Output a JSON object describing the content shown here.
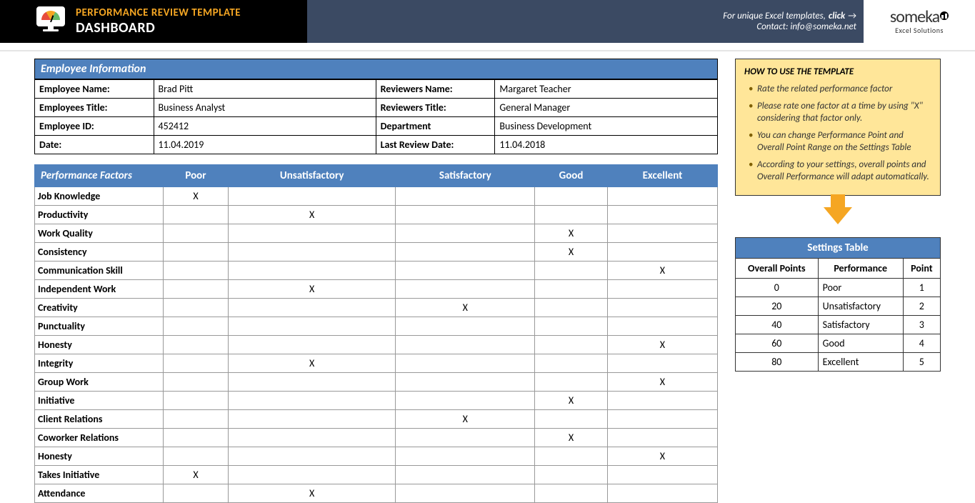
{
  "header": {
    "title1": "PERFORMANCE REVIEW TEMPLATE",
    "title2": "DASHBOARD",
    "link_text": "For unique Excel templates, ",
    "link_action": "click",
    "contact": "Contact: info@someka.net",
    "logo_main": "someka",
    "logo_sub": "Excel Solutions"
  },
  "employee_info": {
    "header": "Employee Information",
    "labels": {
      "emp_name": "Employee Name:",
      "emp_title": "Employees Title:",
      "emp_id": "Employee ID:",
      "date": "Date:",
      "rev_name": "Reviewers Name:",
      "rev_title": "Reviewers Title:",
      "dept": "Department",
      "last_review": "Last Review Date:"
    },
    "values": {
      "emp_name": "Brad Pitt",
      "emp_title": "Business Analyst",
      "emp_id": "452412",
      "date": "11.04.2019",
      "rev_name": "Margaret Teacher",
      "rev_title": "General Manager",
      "dept": "Business Development",
      "last_review": "11.04.2018"
    }
  },
  "performance": {
    "header": "Performance Factors",
    "columns": [
      "Poor",
      "Unsatisfactory",
      "Satisfactory",
      "Good",
      "Excellent"
    ],
    "rows": [
      {
        "name": "Job Knowledge",
        "marks": [
          "X",
          "",
          "",
          "",
          ""
        ]
      },
      {
        "name": "Productivity",
        "marks": [
          "",
          "X",
          "",
          "",
          ""
        ]
      },
      {
        "name": "Work Quality",
        "marks": [
          "",
          "",
          "",
          "X",
          ""
        ]
      },
      {
        "name": "Consistency",
        "marks": [
          "",
          "",
          "",
          "X",
          ""
        ]
      },
      {
        "name": "Communication Skill",
        "marks": [
          "",
          "",
          "",
          "",
          "X"
        ]
      },
      {
        "name": "Independent Work",
        "marks": [
          "",
          "X",
          "",
          "",
          ""
        ]
      },
      {
        "name": "Creativity",
        "marks": [
          "",
          "",
          "X",
          "",
          ""
        ]
      },
      {
        "name": "Punctuality",
        "marks": [
          "",
          "",
          "",
          "",
          ""
        ]
      },
      {
        "name": "Honesty",
        "marks": [
          "",
          "",
          "",
          "",
          "X"
        ]
      },
      {
        "name": "Integrity",
        "marks": [
          "",
          "X",
          "",
          "",
          ""
        ]
      },
      {
        "name": "Group Work",
        "marks": [
          "",
          "",
          "",
          "",
          "X"
        ]
      },
      {
        "name": "Initiative",
        "marks": [
          "",
          "",
          "",
          "X",
          ""
        ]
      },
      {
        "name": "Client Relations",
        "marks": [
          "",
          "",
          "X",
          "",
          ""
        ]
      },
      {
        "name": "Coworker Relations",
        "marks": [
          "",
          "",
          "",
          "X",
          ""
        ]
      },
      {
        "name": "Honesty",
        "marks": [
          "",
          "",
          "",
          "",
          "X"
        ]
      },
      {
        "name": "Takes Initiative",
        "marks": [
          "X",
          "",
          "",
          "",
          ""
        ]
      },
      {
        "name": "Attendance",
        "marks": [
          "",
          "X",
          "",
          "",
          ""
        ]
      }
    ]
  },
  "howto": {
    "title": "HOW TO USE THE TEMPLATE",
    "items": [
      "Rate the related performance factor",
      "Please rate one factor at a time by using \"X\" considering that factor only.",
      "You can change Performance Point and Overall Point Range on the Settings Table",
      "According to your settings, overall points and Overall Performance will adapt automatically."
    ]
  },
  "settings": {
    "title": "Settings Table",
    "columns": [
      "Overall Points",
      "Performance",
      "Point"
    ],
    "rows": [
      {
        "points": "0",
        "perf": "Poor",
        "point": "1"
      },
      {
        "points": "20",
        "perf": "Unsatisfactory",
        "point": "2"
      },
      {
        "points": "40",
        "perf": "Satisfactory",
        "point": "3"
      },
      {
        "points": "60",
        "perf": "Good",
        "point": "4"
      },
      {
        "points": "80",
        "perf": "Excellent",
        "point": "5"
      }
    ]
  }
}
